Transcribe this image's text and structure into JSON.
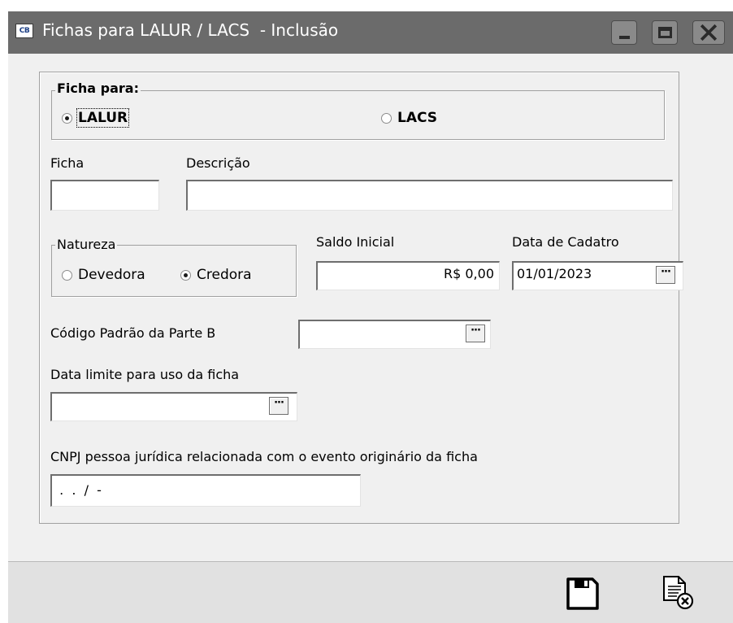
{
  "window": {
    "app_badge": "CB",
    "title": "Fichas para LALUR / LACS  - Inclusão"
  },
  "ficha_para": {
    "legend": "Ficha para:",
    "options": [
      {
        "label": "LALUR",
        "selected": true
      },
      {
        "label": "LACS",
        "selected": false
      }
    ]
  },
  "ficha": {
    "label": "Ficha",
    "value": ""
  },
  "descricao": {
    "label": "Descrição",
    "value": ""
  },
  "natureza": {
    "legend": "Natureza",
    "options": [
      {
        "label": "Devedora",
        "selected": false
      },
      {
        "label": "Credora",
        "selected": true
      }
    ]
  },
  "saldo_inicial": {
    "label": "Saldo Inicial",
    "value": "R$ 0,00"
  },
  "data_cadastro": {
    "label": "Data de Cadatro",
    "value": "01/01/2023",
    "button": "···"
  },
  "codigo_padrao": {
    "label": "Código Padrão da Parte B",
    "value": "",
    "button": "···"
  },
  "data_limite": {
    "label": "Data limite para uso da ficha",
    "value": "",
    "button": "···"
  },
  "cnpj": {
    "label": "CNPJ pessoa jurídica relacionada com o evento originário da ficha",
    "value": " .  .  /  -"
  },
  "footer": {
    "save_icon": "floppy-disk-icon",
    "cancel_icon": "document-cancel-icon"
  },
  "colors": {
    "titlebar": "#6b6b6b",
    "window_bg": "#f0f0f0",
    "footer_bg": "#e1e1e1"
  }
}
